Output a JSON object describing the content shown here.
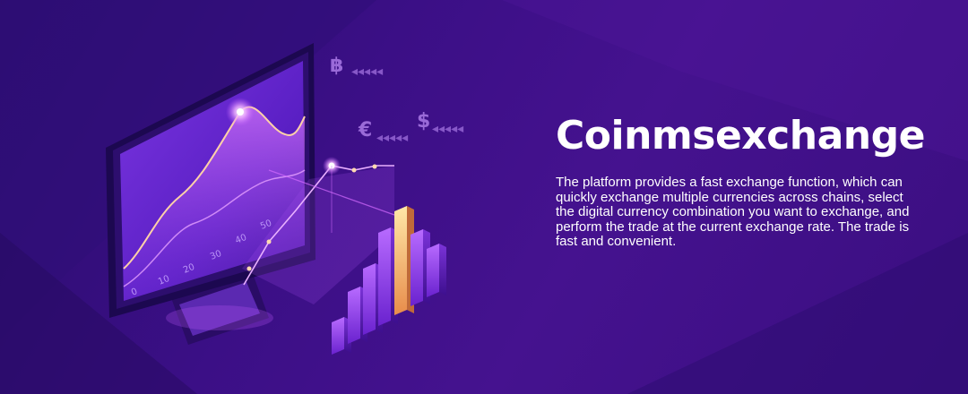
{
  "brand": {
    "name": "Coinmsexchange"
  },
  "description": "The platform provides a fast exchange function, which can quickly exchange multiple currencies across chains, select the digital currency combination you want to exchange, and perform the trade at the current exchange rate. The trade is fast and convenient.",
  "illustration": {
    "currency_symbols": [
      "฿",
      "€",
      "$"
    ],
    "chart_axis_labels": [
      "0",
      "10",
      "20",
      "30",
      "40",
      "50"
    ],
    "colors": {
      "background_dark": "#2a0d6e",
      "background_light": "#45128f",
      "accent_glow": "#d46bff",
      "screen": "#6a2bd6"
    }
  }
}
